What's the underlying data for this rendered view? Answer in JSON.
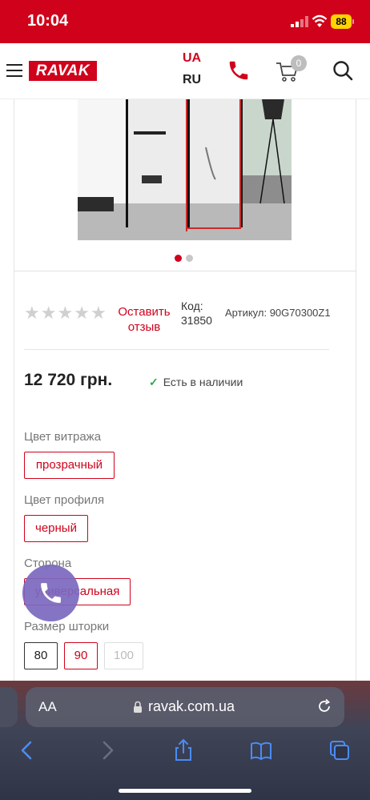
{
  "status_bar": {
    "time": "10:04",
    "battery": "88"
  },
  "header": {
    "logo_text": "RAVAK",
    "lang_active": "UA",
    "lang_other": "RU",
    "cart_count": "0"
  },
  "gallery": {
    "dots": 2,
    "active_index": 0
  },
  "product": {
    "rating_stars": 5,
    "review_link": "Оставить отзыв",
    "code_label": "Код:",
    "code_value": "31850",
    "article": "Артикул:  90G70300Z1",
    "price": "12 720 грн.",
    "stock_status": "Есть в наличии"
  },
  "options": {
    "glass_color_label": "Цвет витража",
    "glass_color_value": "прозрачный",
    "profile_color_label": "Цвет профиля",
    "profile_color_value": "черный",
    "side_label": "Сторона",
    "side_value": "универсальная",
    "size_label": "Размер шторки",
    "sizes": [
      "80",
      "90",
      "100"
    ],
    "selected_size": "90",
    "disabled_size": "100"
  },
  "browser": {
    "aa_label": "AA",
    "url": "ravak.com.ua"
  },
  "colors": {
    "brand": "#d0021b",
    "stock_check": "#2fa84f",
    "call_button": "#7b68be"
  },
  "icons": [
    "hamburger-icon",
    "phone-icon",
    "cart-icon",
    "search-icon",
    "checkmark-icon",
    "phone-handset-icon",
    "lock-icon",
    "reload-icon",
    "back-icon",
    "forward-icon",
    "share-icon",
    "bookmarks-icon",
    "tabs-icon"
  ]
}
